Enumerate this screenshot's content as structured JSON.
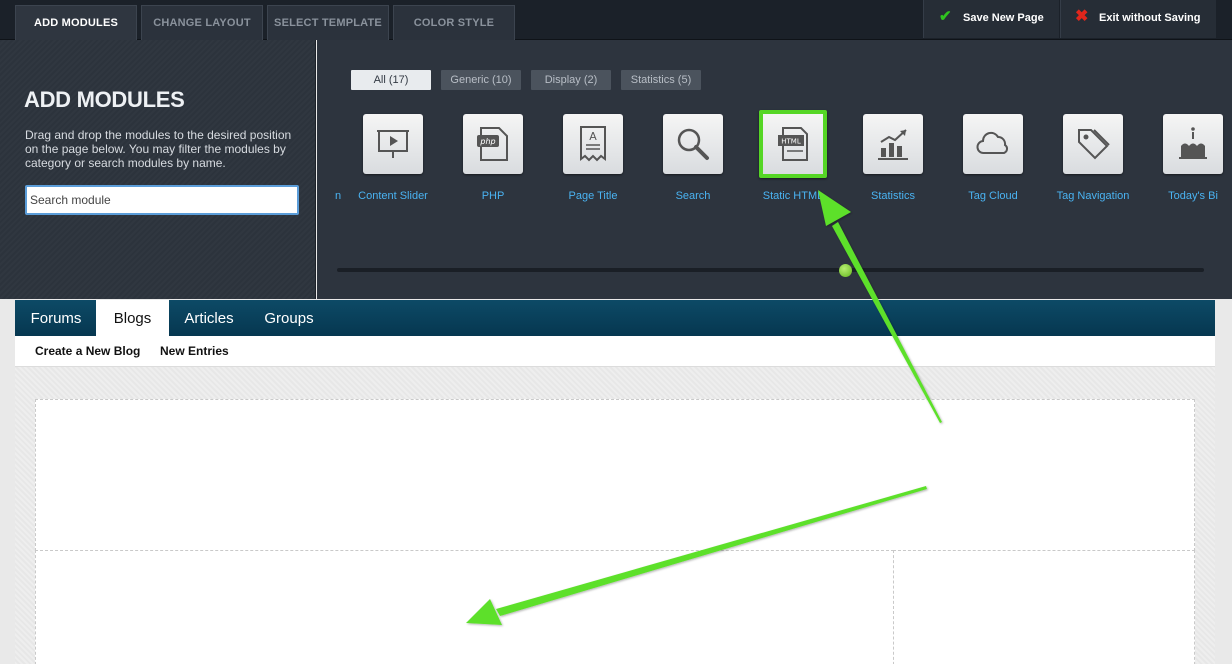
{
  "topbar": {
    "tabs": [
      {
        "label": "ADD MODULES",
        "active": true
      },
      {
        "label": "CHANGE LAYOUT",
        "active": false
      },
      {
        "label": "SELECT TEMPLATE",
        "active": false
      },
      {
        "label": "COLOR STYLE",
        "active": false
      }
    ],
    "save_label": "Save New Page",
    "exit_label": "Exit without Saving",
    "save_icon": "check-icon",
    "exit_icon": "x-icon",
    "colors": {
      "save": "#2fc21f",
      "exit": "#e0261c"
    }
  },
  "left_panel": {
    "title": "ADD MODULES",
    "description": "Drag and drop the modules to the desired position on the page below. You may filter the modules by category or search modules by name.",
    "search_placeholder": "Search module"
  },
  "filters": [
    {
      "label": "All (17)",
      "active": true
    },
    {
      "label": "Generic (10)",
      "active": false
    },
    {
      "label": "Display (2)",
      "active": false
    },
    {
      "label": "Statistics (5)",
      "active": false
    }
  ],
  "modules": {
    "partial_left_label": "n",
    "items": [
      {
        "label": "Content Slider",
        "icon": "presentation-icon"
      },
      {
        "label": "PHP",
        "icon": "php-file-icon"
      },
      {
        "label": "Page Title",
        "icon": "title-document-icon"
      },
      {
        "label": "Search",
        "icon": "magnifier-icon"
      },
      {
        "label": "Static HTML",
        "icon": "html-file-icon",
        "highlighted": true
      },
      {
        "label": "Statistics",
        "icon": "chart-icon"
      },
      {
        "label": "Tag Cloud",
        "icon": "cloud-icon"
      },
      {
        "label": "Tag Navigation",
        "icon": "tag-icon"
      },
      {
        "label": "Today's Bi",
        "icon": "cake-icon"
      }
    ],
    "scroll_position": 0.58
  },
  "page": {
    "nav_tabs": [
      {
        "label": "Forums",
        "active": false
      },
      {
        "label": "Blogs",
        "active": true
      },
      {
        "label": "Articles",
        "active": false
      },
      {
        "label": "Groups",
        "active": false
      }
    ],
    "sub_links": [
      "Create a New Blog",
      "New Entries"
    ]
  },
  "colors": {
    "accent": "#4ab3f2",
    "highlight": "#55d625",
    "nav": "#0a4560"
  }
}
